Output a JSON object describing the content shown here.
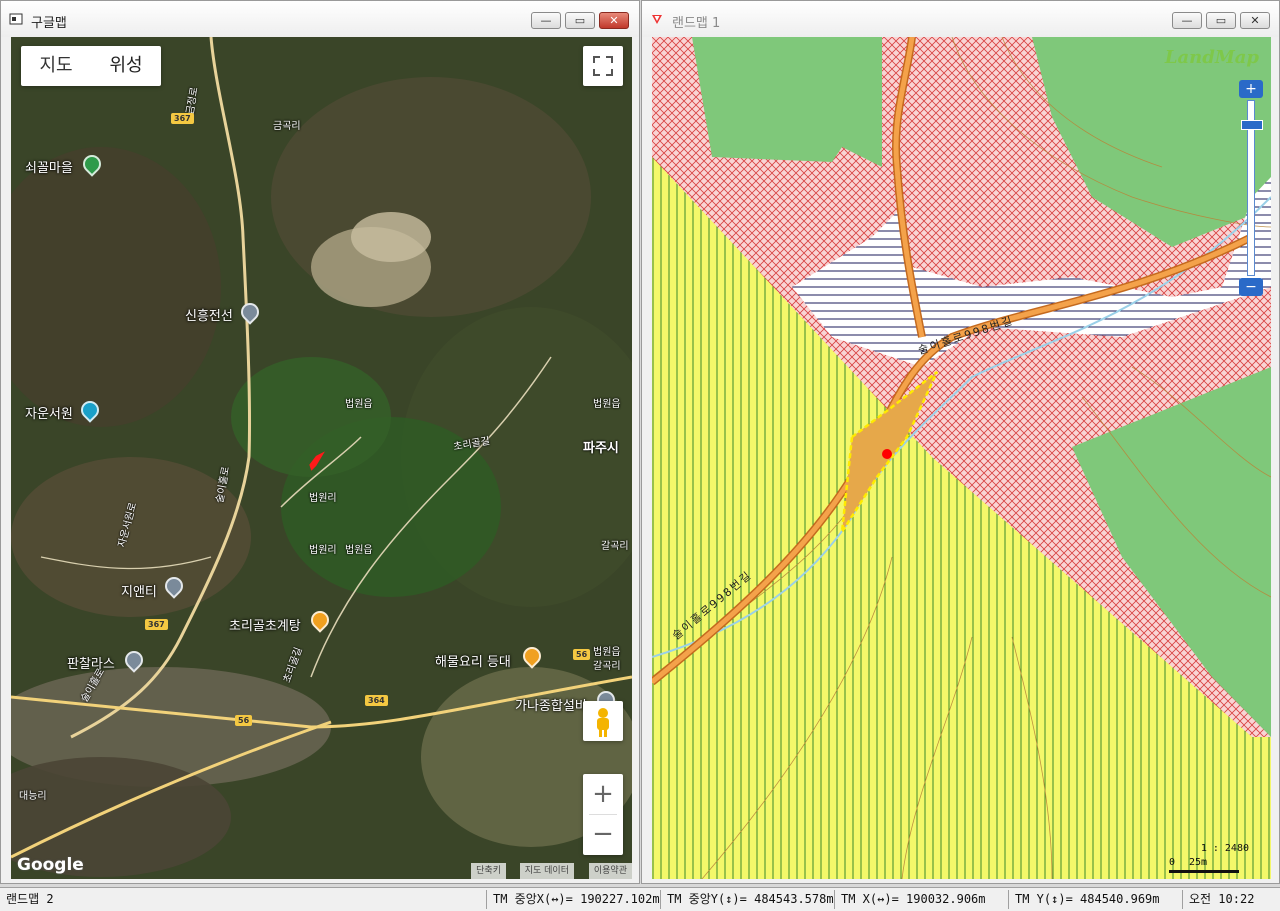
{
  "left_window": {
    "title": "구글맵",
    "map_type": {
      "map": "지도",
      "satellite": "위성"
    },
    "place_labels": {
      "geumgok": "금곡리",
      "beopwon1": "법원읍",
      "beopwon2": "법원읍",
      "beopwon3": "법원읍",
      "beopwon4": "법원읍",
      "beopwon_ri1": "법원리",
      "beopwon_ri2": "법원리",
      "beopwon_ri3": "법원리",
      "galgok1": "갈곡리",
      "galgok2": "갈곡리",
      "paju": "파주시",
      "daeneung": "대능리",
      "choriro": "초리골길",
      "songiro": "술이홀로",
      "jaunseowon_ro": "자운서원로",
      "choriro2": "초리골길",
      "songiro2": "술이홀로",
      "geumjeong": "금정로"
    },
    "poi": {
      "swikkol": "쇠꼴마을",
      "sinheung": "신흥전선",
      "jaunseowon": "자운서원",
      "jient": "지앤티",
      "choricho": "초리골초계탕",
      "panchal": "판찰라스",
      "haemul": "해물요리 등대",
      "gana": "가나종합설비"
    },
    "road_shields": [
      "367",
      "367",
      "56",
      "364",
      "56"
    ],
    "attribution": {
      "shortcuts": "단축키",
      "map_data": "지도 데이터",
      "terms": "이용약관"
    },
    "logo": "Google"
  },
  "right_window": {
    "title": "랜드맵 1",
    "logo": "LandMap",
    "road_label_1": "술이홀로998번길",
    "road_label_2": "술이홀로998번길",
    "scale_ratio": "1 : 2480",
    "scale_zero": "0",
    "scale_len": "25m"
  },
  "window_buttons": {
    "minimize": "—",
    "restore": "▭",
    "close": "✕"
  },
  "status_bar": {
    "app": "랜드맵 2",
    "tm_center_x": "TM 중앙X(↔)= 190227.102m",
    "tm_center_y": "TM 중앙Y(↕)= 484543.578m",
    "tm_x": "TM X(↔)= 190032.906m",
    "tm_y": "TM Y(↕)= 484540.969m",
    "time": "오전 10:22"
  },
  "colors": {
    "zone_yellow": "#f4f86a",
    "zone_green": "#7fc87a",
    "zone_red_hatch": "#e05050",
    "parcel_fill": "#e6a84a",
    "road": "#f4a24a"
  }
}
